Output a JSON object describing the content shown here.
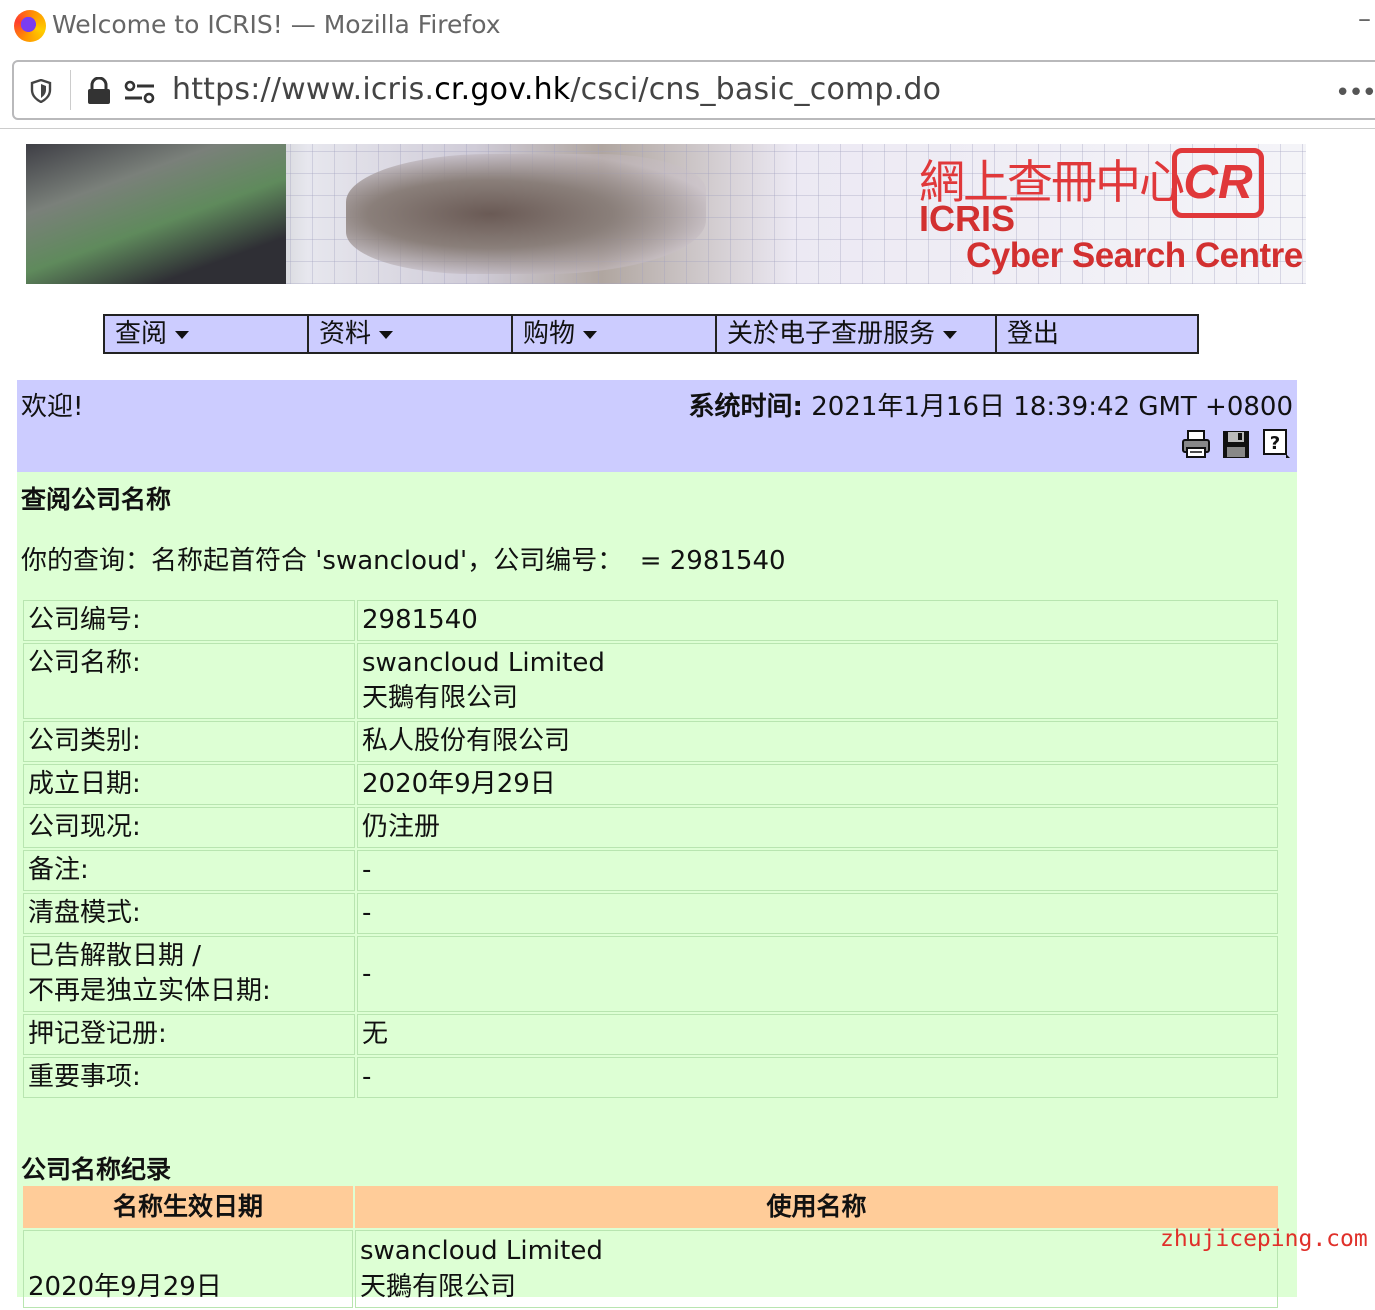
{
  "browser": {
    "window_title": "Welcome to ICRIS! — Mozilla Firefox",
    "url_prefix": "https://www.icris.",
    "url_domain": "cr.gov.hk",
    "url_path": "/csci/cns_basic_comp.do"
  },
  "banner": {
    "cn_title": "網上查冊中心",
    "icris": "ICRIS",
    "subtitle": "Cyber Search Centre",
    "logo": "CR"
  },
  "menu": {
    "items": [
      {
        "label": "查阅",
        "dropdown": true
      },
      {
        "label": "资料",
        "dropdown": true
      },
      {
        "label": "购物",
        "dropdown": true
      },
      {
        "label": "关於电子查册服务",
        "dropdown": true
      },
      {
        "label": "登出",
        "dropdown": false
      }
    ]
  },
  "welcome": {
    "greeting": "欢迎!",
    "systime_label": "系统时间:",
    "systime_value": " 2021年1月16日 18:39:42 GMT +0800",
    "icons": [
      "printer-icon",
      "save-icon",
      "help-icon"
    ]
  },
  "section": {
    "title": "查阅公司名称",
    "query": "你的查询：名称起首符合 'swancloud'，公司编号：  = 2981540"
  },
  "details": [
    {
      "key": "公司编号:",
      "value": "2981540"
    },
    {
      "key": "公司名称:",
      "value": "swancloud Limited",
      "value2": "天鵝有限公司"
    },
    {
      "key": "公司类别:",
      "value": "私人股份有限公司"
    },
    {
      "key": "成立日期:",
      "value": "2020年9月29日"
    },
    {
      "key": "公司现况:",
      "value": "仍注册"
    },
    {
      "key": "备注:",
      "value": "-"
    },
    {
      "key": "清盘模式:",
      "value": "-"
    },
    {
      "key": "已告解散日期 /",
      "key2": "不再是独立实体日期:",
      "value": "-"
    },
    {
      "key": "押记登记册:",
      "value": "无"
    },
    {
      "key": "重要事项:",
      "value": "-"
    }
  ],
  "history": {
    "title": "公司名称纪录",
    "col1": "名称生效日期",
    "col2": "使用名称",
    "rows": [
      {
        "date": "2020年9月29日",
        "name1": "swancloud Limited",
        "name2": "天鵝有限公司"
      }
    ]
  },
  "watermark": "zhujiceping.com"
}
